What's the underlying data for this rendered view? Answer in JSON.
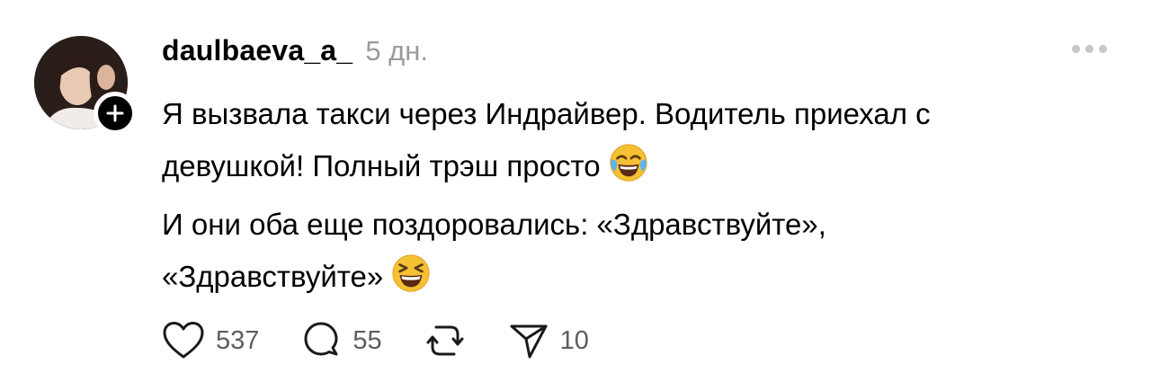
{
  "post": {
    "username": "daulbaeva_a_",
    "time": "5 дн.",
    "paragraphs": [
      {
        "lines": [
          "Я вызвала такси через Индрайвер. Водитель приехал с",
          "девушкой! Полный трэш просто"
        ],
        "emoji": "face-with-tears-of-joy"
      },
      {
        "lines": [
          "И они оба еще поздоровались: «Здравствуйте»,",
          "«Здравствуйте»"
        ],
        "emoji": "grinning-squinting-face"
      }
    ],
    "actions": {
      "likes": "537",
      "comments": "55",
      "repost": "",
      "shares": "10"
    }
  },
  "colors": {
    "text": "#000000",
    "secondary": "#9a9a9a",
    "counts": "#5d5d5d",
    "emoji_yellow": "#f5c033"
  },
  "icons": [
    "follow-plus-icon",
    "more-icon",
    "heart-icon",
    "comment-icon",
    "repost-icon",
    "share-icon"
  ]
}
